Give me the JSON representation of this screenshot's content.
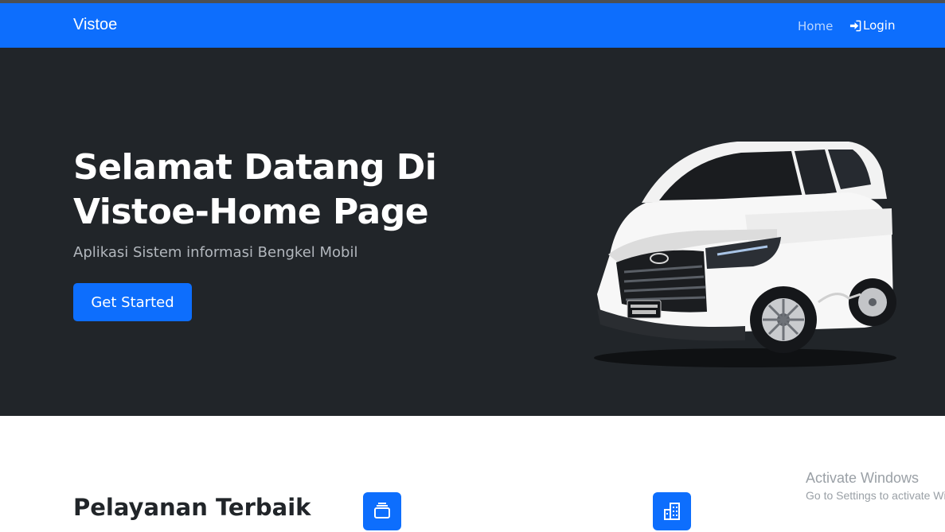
{
  "navbar": {
    "brand": "Vistoe",
    "links": [
      {
        "label": "Home"
      },
      {
        "label": "Login",
        "icon": "login-icon"
      }
    ],
    "background": "#0d6efd"
  },
  "hero": {
    "title_line1": "Selamat Datang Di",
    "title_line2": "Vistoe-Home Page",
    "subtitle": "Aplikasi Sistem informasi Bengkel Mobil",
    "cta_label": "Get Started",
    "image": "white-mpv-car-image",
    "background": "#212529"
  },
  "services": {
    "title": "Pelayanan Terbaik",
    "feature_icons": [
      "collection-icon",
      "building-icon"
    ]
  },
  "watermark": {
    "title": "Activate Windows",
    "subtitle": "Go to Settings to activate Windows."
  }
}
